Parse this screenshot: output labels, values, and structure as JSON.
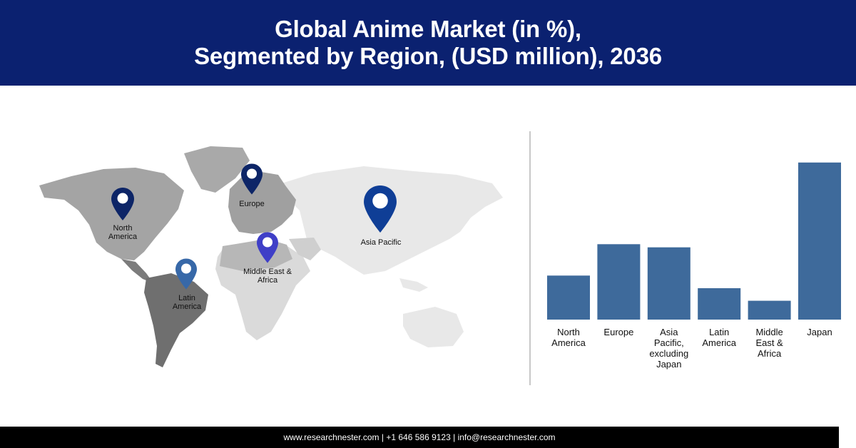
{
  "header": {
    "title_line1": "Global Anime Market (in %),",
    "title_line2": "Segmented by Region, (USD million), 2036"
  },
  "map": {
    "regions": [
      {
        "name": "North America",
        "label_lines": [
          "North",
          "America"
        ],
        "pin_color": "#0d2567"
      },
      {
        "name": "Europe",
        "label_lines": [
          "Europe"
        ],
        "pin_color": "#0d2567"
      },
      {
        "name": "Asia Pacific",
        "label_lines": [
          "Asia Pacific"
        ],
        "pin_color": "#0f3e96"
      },
      {
        "name": "Middle East & Africa",
        "label_lines": [
          "Middle East &",
          "Africa"
        ],
        "pin_color": "#3f3fc7"
      },
      {
        "name": "Latin America",
        "label_lines": [
          "Latin",
          "America"
        ],
        "pin_color": "#3768a8"
      }
    ]
  },
  "chart_data": {
    "type": "bar",
    "categories": [
      "North America",
      "Europe",
      "Asia Pacific, excluding Japan",
      "Latin America",
      "Middle East & Africa",
      "Japan"
    ],
    "category_label_lines": [
      [
        "North",
        "America"
      ],
      [
        "Europe"
      ],
      [
        "Asia",
        "Pacific,",
        "excluding",
        "Japan"
      ],
      [
        "Latin",
        "America"
      ],
      [
        "Middle",
        "East &",
        "Africa"
      ],
      [
        "Japan"
      ]
    ],
    "values": [
      14,
      24,
      23,
      10,
      6,
      50
    ],
    "ylim": [
      0,
      52
    ],
    "bar_color": "#3e6a9b",
    "grid": false,
    "legend": "none"
  },
  "footer": {
    "website": "www.researchnester.com",
    "separator": " | ",
    "phone": "+1 646 586 9123",
    "email": "info@researchnester.com"
  }
}
